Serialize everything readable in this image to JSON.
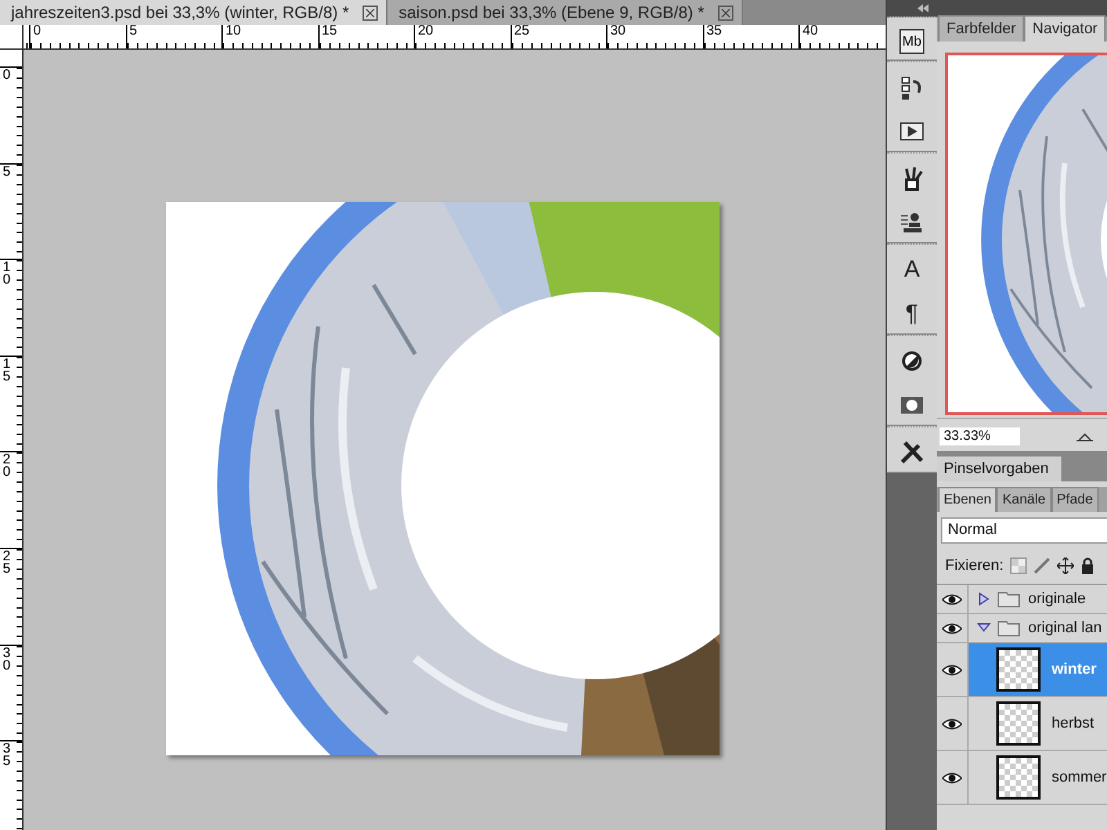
{
  "tabs": [
    {
      "label": "jahreszeiten3.psd bei 33,3% (winter, RGB/8) *",
      "selected": true
    },
    {
      "label": "saison.psd bei 33,3% (Ebene 9, RGB/8) *",
      "selected": false
    }
  ],
  "rulers": {
    "horizontal": [
      "0",
      "5",
      "10",
      "15",
      "20",
      "25",
      "30",
      "35",
      "40"
    ],
    "vertical": [
      "0",
      "5",
      "10",
      "15",
      "20",
      "25",
      "30",
      "35"
    ]
  },
  "toolstrip": {
    "bridge_text": "Mb",
    "type_text": "A",
    "paragraph_text": "¶"
  },
  "panel_tabs": [
    {
      "label": "Farbfelder",
      "selected": false
    },
    {
      "label": "Navigator",
      "selected": true
    }
  ],
  "navigator": {
    "zoom": "33.33%"
  },
  "brush_panel": {
    "title": "Pinselvorgaben"
  },
  "layer_tabs": [
    {
      "label": "Ebenen",
      "selected": true
    },
    {
      "label": "Kanäle",
      "selected": false
    },
    {
      "label": "Pfade",
      "selected": false
    }
  ],
  "blend_mode": "Normal",
  "lock_label": "Fixieren:",
  "layers": [
    {
      "name": "originale",
      "kind": "group",
      "expanded": false,
      "visible": true,
      "selected": false
    },
    {
      "name": "original lan",
      "kind": "group",
      "expanded": true,
      "visible": true,
      "selected": false,
      "children": [
        {
          "name": "winter",
          "kind": "smart",
          "visible": true,
          "selected": true
        },
        {
          "name": "herbst",
          "kind": "smart",
          "visible": true,
          "selected": false
        },
        {
          "name": "sommer",
          "kind": "smart",
          "visible": true,
          "selected": false
        }
      ]
    }
  ]
}
